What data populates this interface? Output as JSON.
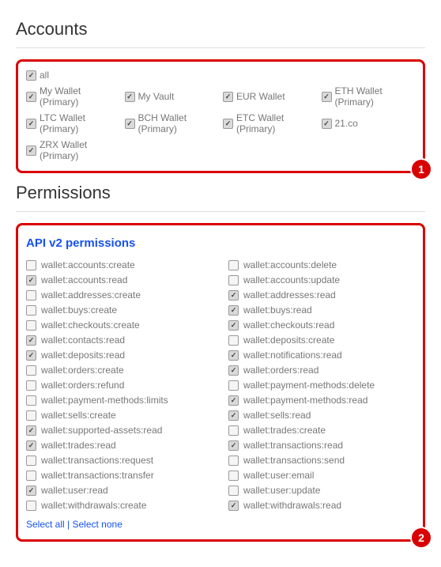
{
  "accounts": {
    "heading": "Accounts",
    "all_label": "all",
    "items": [
      {
        "label": "My Wallet (Primary)",
        "checked": true
      },
      {
        "label": "My Vault",
        "checked": true
      },
      {
        "label": "EUR Wallet",
        "checked": true
      },
      {
        "label": "ETH Wallet (Primary)",
        "checked": true
      },
      {
        "label": "LTC Wallet (Primary)",
        "checked": true
      },
      {
        "label": "BCH Wallet (Primary)",
        "checked": true
      },
      {
        "label": "ETC Wallet (Primary)",
        "checked": true
      },
      {
        "label": "21.co",
        "checked": true
      },
      {
        "label": "ZRX Wallet (Primary)",
        "checked": true
      }
    ],
    "badge": "1"
  },
  "permissions": {
    "heading": "Permissions",
    "subheading": "API v2 permissions",
    "items": [
      {
        "label": "wallet:accounts:create",
        "checked": false
      },
      {
        "label": "wallet:accounts:delete",
        "checked": false
      },
      {
        "label": "wallet:accounts:read",
        "checked": true
      },
      {
        "label": "wallet:accounts:update",
        "checked": false
      },
      {
        "label": "wallet:addresses:create",
        "checked": false
      },
      {
        "label": "wallet:addresses:read",
        "checked": true
      },
      {
        "label": "wallet:buys:create",
        "checked": false
      },
      {
        "label": "wallet:buys:read",
        "checked": true
      },
      {
        "label": "wallet:checkouts:create",
        "checked": false
      },
      {
        "label": "wallet:checkouts:read",
        "checked": true
      },
      {
        "label": "wallet:contacts:read",
        "checked": true
      },
      {
        "label": "wallet:deposits:create",
        "checked": false
      },
      {
        "label": "wallet:deposits:read",
        "checked": true
      },
      {
        "label": "wallet:notifications:read",
        "checked": true
      },
      {
        "label": "wallet:orders:create",
        "checked": false
      },
      {
        "label": "wallet:orders:read",
        "checked": true
      },
      {
        "label": "wallet:orders:refund",
        "checked": false
      },
      {
        "label": "wallet:payment-methods:delete",
        "checked": false
      },
      {
        "label": "wallet:payment-methods:limits",
        "checked": false
      },
      {
        "label": "wallet:payment-methods:read",
        "checked": true
      },
      {
        "label": "wallet:sells:create",
        "checked": false
      },
      {
        "label": "wallet:sells:read",
        "checked": true
      },
      {
        "label": "wallet:supported-assets:read",
        "checked": true
      },
      {
        "label": "wallet:trades:create",
        "checked": false
      },
      {
        "label": "wallet:trades:read",
        "checked": true
      },
      {
        "label": "wallet:transactions:read",
        "checked": true
      },
      {
        "label": "wallet:transactions:request",
        "checked": false
      },
      {
        "label": "wallet:transactions:send",
        "checked": false
      },
      {
        "label": "wallet:transactions:transfer",
        "checked": false
      },
      {
        "label": "wallet:user:email",
        "checked": false
      },
      {
        "label": "wallet:user:read",
        "checked": true
      },
      {
        "label": "wallet:user:update",
        "checked": false
      },
      {
        "label": "wallet:withdrawals:create",
        "checked": false
      },
      {
        "label": "wallet:withdrawals:read",
        "checked": true
      }
    ],
    "select_all": "Select all",
    "select_none": "Select none",
    "badge": "2"
  }
}
